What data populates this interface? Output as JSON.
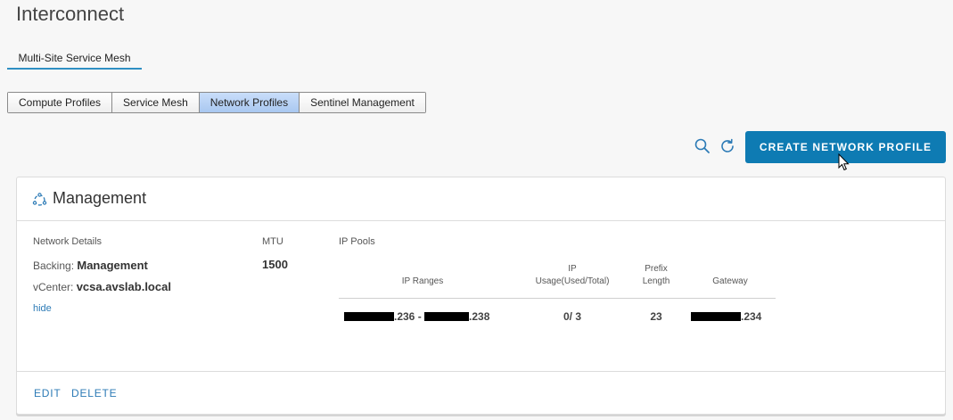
{
  "page": {
    "title": "Interconnect"
  },
  "subtab": {
    "label": "Multi-Site Service Mesh"
  },
  "tabs": [
    {
      "label": "Compute Profiles",
      "active": false
    },
    {
      "label": "Service Mesh",
      "active": false
    },
    {
      "label": "Network Profiles",
      "active": true
    },
    {
      "label": "Sentinel Management",
      "active": false
    }
  ],
  "toolbar": {
    "search_icon": "search-icon",
    "refresh_icon": "refresh-icon",
    "create_label": "CREATE NETWORK PROFILE"
  },
  "profile": {
    "name": "Management",
    "icon": "network-profile-icon",
    "network_details_label": "Network Details",
    "backing_label": "Backing:",
    "backing_value": "Management",
    "vcenter_label": "vCenter:",
    "vcenter_value": "vcsa.avslab.local",
    "hide_label": "hide",
    "mtu_label": "MTU",
    "mtu_value": "1500",
    "ip_pools_label": "IP Pools",
    "columns": {
      "ip_ranges": "IP Ranges",
      "usage_line1": "IP",
      "usage_line2": "Usage(Used/Total)",
      "prefix_line1": "Prefix",
      "prefix_line2": "Length",
      "gateway": "Gateway"
    },
    "row": {
      "range_start_suffix": ".236 - ",
      "range_end_suffix": ".238",
      "usage": "0/ 3",
      "prefix": "23",
      "gateway_suffix": ".234"
    }
  },
  "actions": {
    "edit": "EDIT",
    "delete": "DELETE"
  },
  "colors": {
    "accent": "#0e7bb3",
    "link": "#2d7bb6",
    "active_tab": "#b8d3f5"
  }
}
